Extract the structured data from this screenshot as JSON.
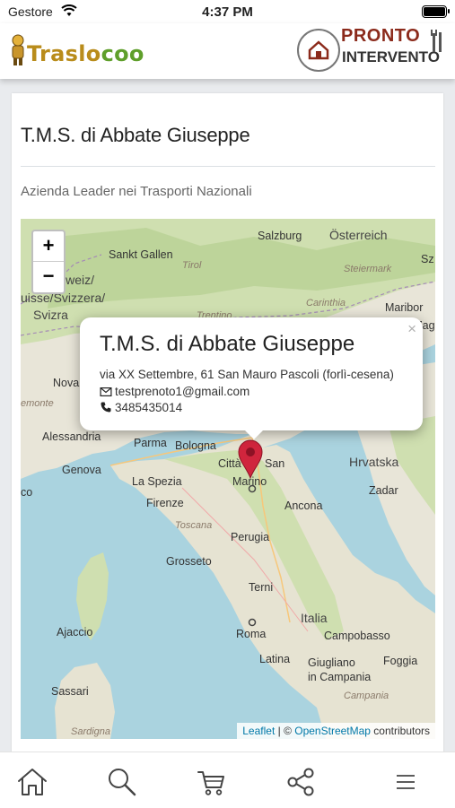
{
  "status_bar": {
    "carrier": "Gestore",
    "time": "4:37 PM"
  },
  "header": {
    "logo_text_a": "Traslo",
    "logo_text_b": "co",
    "logo_text_c": "o",
    "pronto_top": "PRONTO",
    "pronto_bottom": "INTERVENTO"
  },
  "card": {
    "title": "T.M.S. di Abbate Giuseppe",
    "subtitle": "Azienda Leader nei Trasporti Nazionali"
  },
  "map": {
    "zoom_in": "+",
    "zoom_out": "−",
    "labels": [
      {
        "text": "Salzburg",
        "cls": "city"
      },
      {
        "text": "Österreich",
        "cls": "big"
      },
      {
        "text": "Sankt Gallen",
        "cls": "city"
      },
      {
        "text": "Tirol",
        "cls": "ital"
      },
      {
        "text": "Steiermark",
        "cls": "ital"
      },
      {
        "text": "Schweiz/",
        "cls": "big"
      },
      {
        "text": "uisse/Svizzera/",
        "cls": "big"
      },
      {
        "text": "Svizra",
        "cls": "big"
      },
      {
        "text": "Carinthia",
        "cls": "ital"
      },
      {
        "text": "Maribor",
        "cls": "city"
      },
      {
        "text": "Trentino",
        "cls": "ital"
      },
      {
        "text": "Nova",
        "cls": "city"
      },
      {
        "text": "emonte",
        "cls": "ital"
      },
      {
        "text": "Alessandria",
        "cls": "city"
      },
      {
        "text": "Parma",
        "cls": "city"
      },
      {
        "text": "Bologna",
        "cls": "city"
      },
      {
        "text": "Città",
        "cls": "city"
      },
      {
        "text": "San",
        "cls": "city"
      },
      {
        "text": "Marino",
        "cls": "city"
      },
      {
        "text": "Hrvatska",
        "cls": "big"
      },
      {
        "text": "Genova",
        "cls": "city"
      },
      {
        "text": "La Spezia",
        "cls": "city"
      },
      {
        "text": "Zadar",
        "cls": "city"
      },
      {
        "text": "Firenze",
        "cls": "city"
      },
      {
        "text": "Ancona",
        "cls": "city"
      },
      {
        "text": "Toscana",
        "cls": "ital"
      },
      {
        "text": "Perugia",
        "cls": "city"
      },
      {
        "text": "Grosseto",
        "cls": "city"
      },
      {
        "text": "Terni",
        "cls": "city"
      },
      {
        "text": "Italia",
        "cls": "big"
      },
      {
        "text": "Ajaccio",
        "cls": "city"
      },
      {
        "text": "Roma",
        "cls": "city"
      },
      {
        "text": "Campobasso",
        "cls": "city"
      },
      {
        "text": "Latina",
        "cls": "city"
      },
      {
        "text": "Giugliano",
        "cls": "city"
      },
      {
        "text": "in Campania",
        "cls": "city"
      },
      {
        "text": "Foggia",
        "cls": "city"
      },
      {
        "text": "Sassari",
        "cls": "city"
      },
      {
        "text": "Campania",
        "cls": "ital"
      },
      {
        "text": "Sardigna",
        "cls": "ital"
      },
      {
        "text": "co",
        "cls": "city"
      },
      {
        "text": "Zag",
        "cls": "city"
      },
      {
        "text": "Sz",
        "cls": "city"
      }
    ],
    "attribution": {
      "leaflet": "Leaflet",
      "sep": " | © ",
      "osm": "OpenStreetMap",
      "contributors": " contributors"
    }
  },
  "popup": {
    "close": "×",
    "title": "T.M.S. di Abbate Giuseppe",
    "address": "via XX Settembre, 61 San Mauro Pascoli (forlì-cesena)",
    "email": "testprenoto1@gmail.com",
    "phone": "3485435014"
  },
  "bottom_nav": [
    "home-icon",
    "search-icon",
    "cart-icon",
    "share-icon",
    "menu-icon"
  ]
}
